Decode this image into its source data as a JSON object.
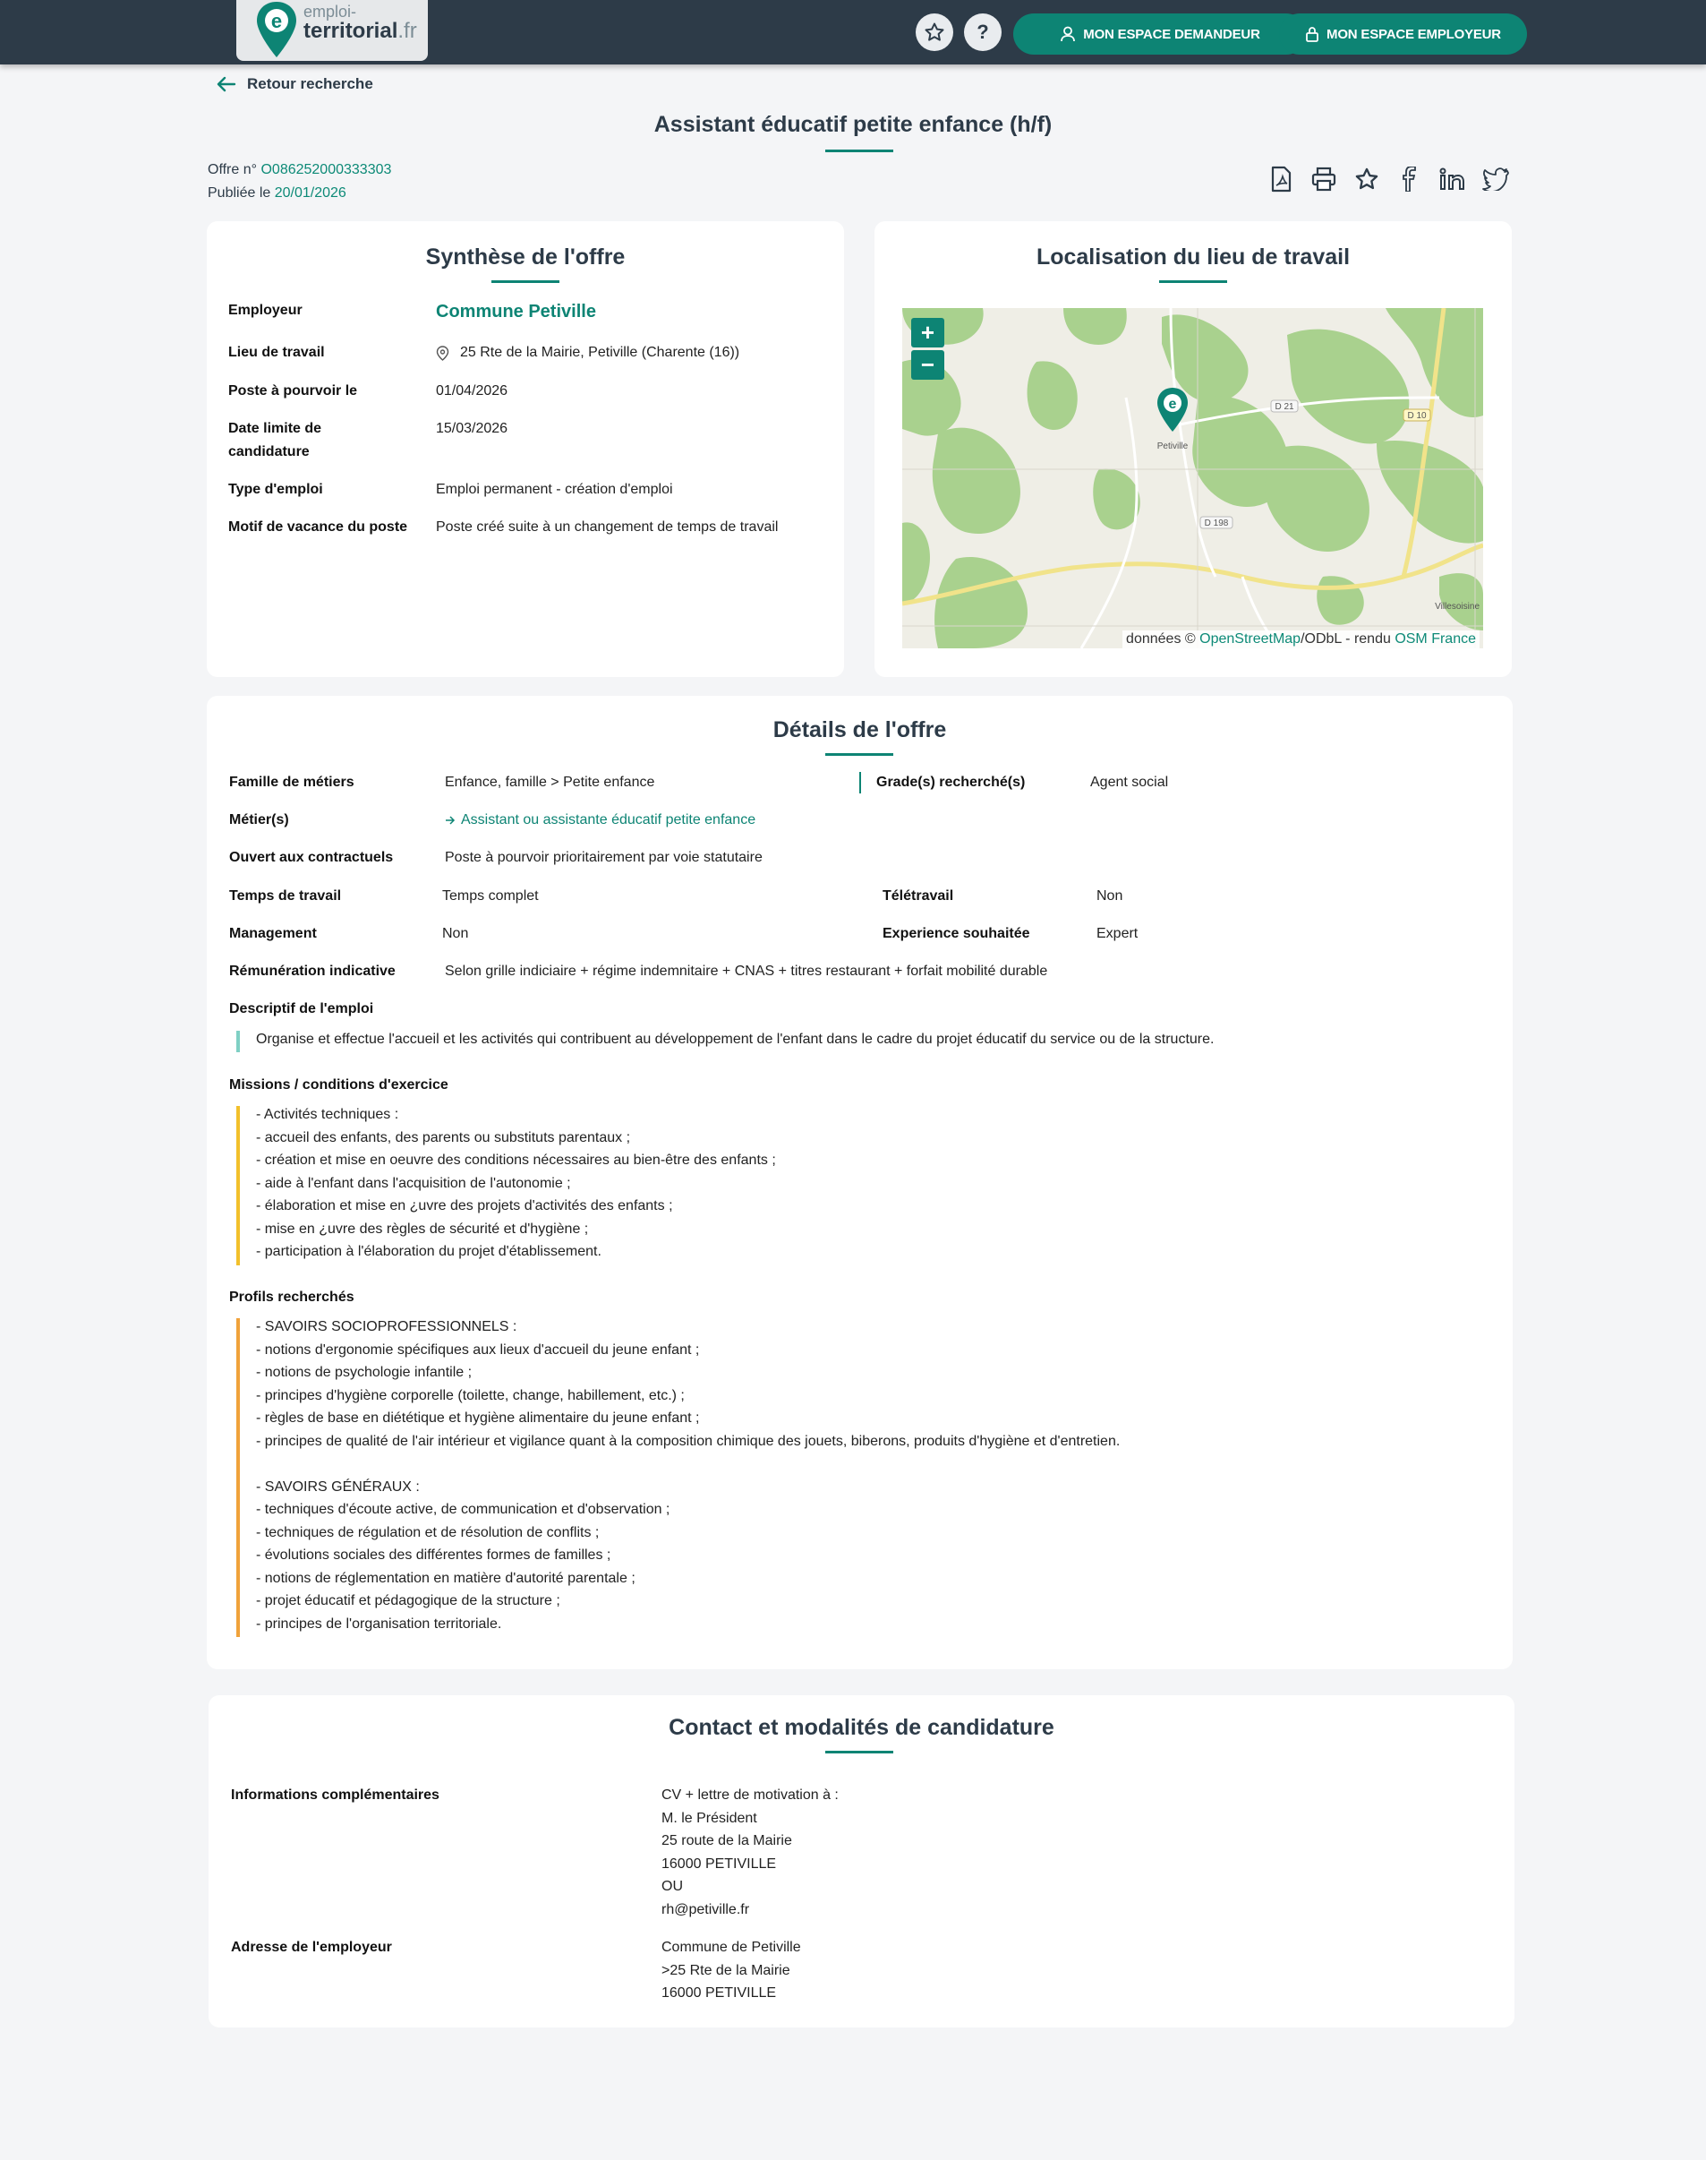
{
  "header": {
    "logo_line1": "emploi-",
    "logo_line2": "territorial",
    "logo_ext": ".fr",
    "help_label": "?",
    "btn_demandeur": "MON ESPACE DEMANDEUR",
    "btn_employeur": "MON ESPACE EMPLOYEUR"
  },
  "nav": {
    "back_label": "Retour recherche"
  },
  "offer": {
    "title": "Assistant éducatif petite enfance (h/f)",
    "number_label": "Offre n°",
    "number": "O086252000333303",
    "published_label": "Publiée le",
    "published_date": "20/01/2026"
  },
  "synthese": {
    "title": "Synthèse de l'offre",
    "rows": [
      {
        "label": "Employeur",
        "value": "Commune Petiville"
      },
      {
        "label": "Lieu de travail",
        "value": "25 Rte de la Mairie, Petiville (Charente (16))"
      },
      {
        "label": "Poste à pourvoir le",
        "value": "01/04/2026"
      },
      {
        "label": "Date limite de",
        "label2": "candidature",
        "value": "15/03/2026"
      },
      {
        "label": "Type d'emploi",
        "value": "Emploi permanent - création d'emploi"
      },
      {
        "label": "Motif de vacance du poste",
        "value": "Poste créé suite à un changement de temps de travail"
      }
    ]
  },
  "localisation": {
    "title": "Localisation du lieu de travail",
    "zoom_in": "+",
    "zoom_out": "−",
    "place_petiville": "Petiville",
    "place_villesoisine": "Villesoisine",
    "road_d21": "D 21",
    "road_d10": "D 10",
    "road_d198": "D 198",
    "attrib_prefix": "données © ",
    "attrib_osm": "OpenStreetMap",
    "attrib_middle": "/ODbL - rendu ",
    "attrib_osmfr": "OSM France"
  },
  "details": {
    "title": "Détails de l'offre",
    "famille_label": "Famille de métiers",
    "famille_value": "Enfance, famille > Petite enfance",
    "grade_label": "Grade(s) recherché(s)",
    "grade_value": "Agent social",
    "metier_label": "Métier(s)",
    "metier_value": "Assistant ou assistante éducatif petite enfance",
    "ouvert_label": "Ouvert aux contractuels",
    "ouvert_value": "Poste à pourvoir prioritairement par voie statutaire",
    "temps_label": "Temps de travail",
    "temps_value": "Temps complet",
    "teletravail_label": "Télétravail",
    "teletravail_value": "Non",
    "management_label": "Management",
    "management_value": "Non",
    "experience_label": "Experience souhaitée",
    "experience_value": "Expert",
    "remuneration_label": "Rémunération indicative",
    "remuneration_value": "Selon grille indiciaire + régime indemnitaire + CNAS + titres restaurant + forfait mobilité durable",
    "descriptif_label": "Descriptif de l'emploi",
    "descriptif_text": "Organise et effectue l'accueil et les activités qui contribuent au développement de l'enfant dans le cadre du projet éducatif du service ou de la structure.",
    "missions_label": "Missions / conditions d'exercice",
    "missions_lines": [
      "- Activités techniques :",
      "- accueil des enfants, des parents ou substituts parentaux ;",
      "- création et mise en oeuvre des conditions nécessaires au bien-être des enfants ;",
      "- aide à l'enfant dans l'acquisition de l'autonomie ;",
      "- élaboration et mise en ¿uvre des projets d'activités des enfants ;",
      "- mise en ¿uvre des règles de sécurité et d'hygiène ;",
      "- participation à l'élaboration du projet d'établissement."
    ],
    "profils_label": "Profils recherchés",
    "profils_lines": [
      "- SAVOIRS SOCIOPROFESSIONNELS :",
      "- notions d'ergonomie spécifiques aux lieux d'accueil du jeune enfant ;",
      "- notions de psychologie infantile ;",
      "- principes d'hygiène corporelle (toilette, change, habillement, etc.) ;",
      "- règles de base en diététique et hygiène alimentaire du jeune enfant ;",
      "- principes de qualité de l'air intérieur et vigilance quant à la composition chimique des jouets, biberons, produits d'hygiène et d'entretien.",
      "",
      "- SAVOIRS GÉNÉRAUX :",
      "- techniques d'écoute active, de communication et d'observation ;",
      "- techniques de régulation et de résolution de conflits ;",
      "- évolutions sociales des différentes formes de familles ;",
      "- notions de réglementation en matière d'autorité parentale ;",
      "- projet éducatif et pédagogique de la structure ;",
      "- principes de l'organisation territoriale."
    ]
  },
  "contact": {
    "title": "Contact et modalités de candidature",
    "infos_label": "Informations complémentaires",
    "infos_lines": [
      "CV + lettre de motivation à :",
      "M. le Président",
      "25 route de la Mairie",
      "16000 PETIVILLE",
      "OU",
      "rh@petiville.fr"
    ],
    "adresse_label": "Adresse de l'employeur",
    "adresse_lines": [
      "Commune de Petiville",
      ">25 Rte de la Mairie",
      "16000 PETIVILLE"
    ]
  },
  "colors": {
    "header_bg": "#2d3b48",
    "accent": "#0d8474",
    "bar_teal_light": "#7fd0c4",
    "bar_yellow": "#f2c02b",
    "bar_orange": "#f0a23a"
  },
  "icons": [
    "star-icon",
    "help-icon",
    "user-icon",
    "lock-icon",
    "arrow-left-icon",
    "pdf-icon",
    "print-icon",
    "facebook-icon",
    "linkedin-icon",
    "twitter-icon",
    "location-pin-icon",
    "arrow-right-icon"
  ]
}
